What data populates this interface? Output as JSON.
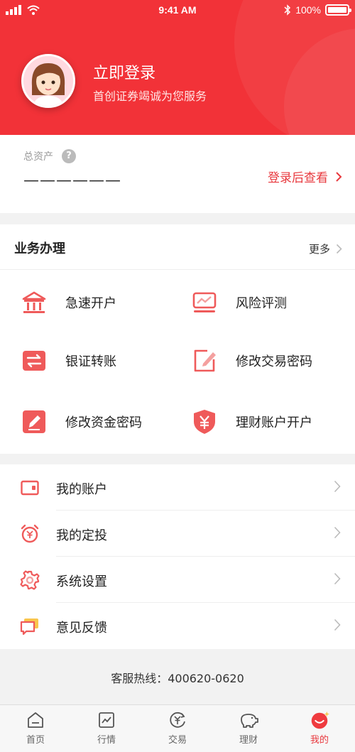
{
  "status_bar": {
    "time": "9:41 AM",
    "battery": "100%"
  },
  "profile": {
    "title": "立即登录",
    "subtitle": "首创证券竭诚为您服务"
  },
  "assets": {
    "label": "总资产",
    "help_icon_text": "?",
    "value_placeholder": "——————",
    "view_label": "登录后查看"
  },
  "business": {
    "title": "业务办理",
    "more_label": "更多",
    "items": [
      {
        "label": "急速开户",
        "icon": "bank-icon"
      },
      {
        "label": "风险评测",
        "icon": "chart-icon"
      },
      {
        "label": "银证转账",
        "icon": "transfer-icon"
      },
      {
        "label": "修改交易密码",
        "icon": "edit-icon"
      },
      {
        "label": "修改资金密码",
        "icon": "pencil-icon"
      },
      {
        "label": "理财账户开户",
        "icon": "shield-yen-icon"
      }
    ]
  },
  "menu": {
    "items": [
      {
        "label": "我的账户",
        "icon": "wallet-icon"
      },
      {
        "label": "我的定投",
        "icon": "alarm-yen-icon"
      },
      {
        "label": "系统设置",
        "icon": "gear-icon"
      },
      {
        "label": "意见反馈",
        "icon": "feedback-icon"
      }
    ]
  },
  "hotline": "客服热线：400620-0620",
  "tabs": [
    {
      "label": "首页",
      "icon": "home-icon",
      "active": false
    },
    {
      "label": "行情",
      "icon": "market-icon",
      "active": false
    },
    {
      "label": "交易",
      "icon": "trade-icon",
      "active": false
    },
    {
      "label": "理财",
      "icon": "piggy-icon",
      "active": false
    },
    {
      "label": "我的",
      "icon": "profile-icon",
      "active": true
    }
  ],
  "colors": {
    "brand_red": "#f23238",
    "accent_red": "#e8383d",
    "background": "#f2f2f2"
  }
}
